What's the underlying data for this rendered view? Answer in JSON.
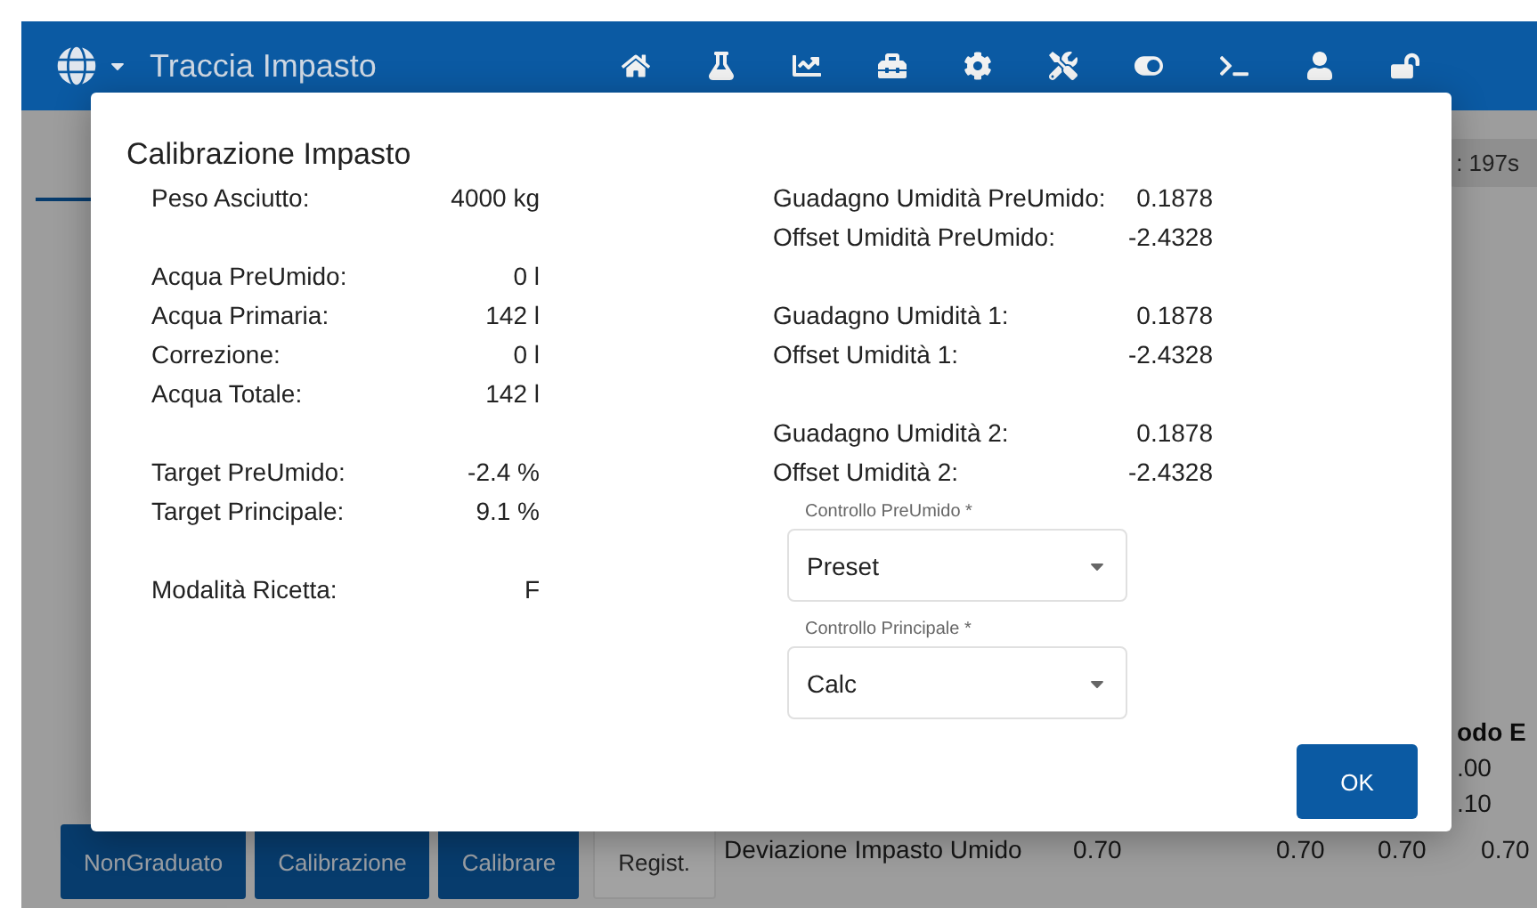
{
  "app_bar": {
    "title": "Traccia Impasto",
    "icons": [
      {
        "kind": "home"
      },
      {
        "kind": "flask"
      },
      {
        "kind": "chart"
      },
      {
        "kind": "toolbox"
      },
      {
        "kind": "gear"
      },
      {
        "kind": "tools"
      },
      {
        "kind": "toggle"
      },
      {
        "kind": "terminal"
      },
      {
        "kind": "user"
      },
      {
        "kind": "unlock"
      }
    ]
  },
  "timer_chip": ": 197s",
  "table": {
    "header": "odo E",
    "column_values": [
      ".00",
      ".10"
    ],
    "row": {
      "label": "Deviazione Impasto Umido",
      "values": [
        "0.70",
        "0.70",
        "0.70",
        "0.70"
      ]
    }
  },
  "buttons": [
    {
      "label": "NonGraduato",
      "kind": "primary"
    },
    {
      "label": "Calibrazione",
      "kind": "primary"
    },
    {
      "label": "Calibrare",
      "kind": "primary"
    },
    {
      "label": "Regist.",
      "kind": "secondary"
    }
  ],
  "dialog": {
    "title": "Calibrazione Impasto",
    "left_groups": [
      [
        {
          "label": "Peso Asciutto:",
          "value": "4000 kg"
        }
      ],
      [
        {
          "label": "Acqua PreUmido:",
          "value": "0 l"
        },
        {
          "label": "Acqua Primaria:",
          "value": "142 l"
        },
        {
          "label": "Correzione:",
          "value": "0 l"
        },
        {
          "label": "Acqua Totale:",
          "value": "142 l"
        }
      ],
      [
        {
          "label": "Target PreUmido:",
          "value": "-2.4 %"
        },
        {
          "label": "Target Principale:",
          "value": "9.1 %"
        }
      ],
      [
        {
          "label": "Modalità Ricetta:",
          "value": "F"
        }
      ]
    ],
    "right_groups": [
      [
        {
          "label": "Guadagno Umidità PreUmido:",
          "value": "0.1878"
        },
        {
          "label": "Offset Umidità PreUmido:",
          "value": "-2.4328"
        }
      ],
      [
        {
          "label": "Guadagno Umidità 1:",
          "value": "0.1878"
        },
        {
          "label": "Offset Umidità 1:",
          "value": "-2.4328"
        }
      ],
      [
        {
          "label": "Guadagno Umidità 2:",
          "value": "0.1878"
        },
        {
          "label": "Offset Umidità 2:",
          "value": "-2.4328"
        }
      ]
    ],
    "selects": [
      {
        "label": "Controllo PreUmido *",
        "value": "Preset"
      },
      {
        "label": "Controllo Principale *",
        "value": "Calc"
      }
    ],
    "ok_button": "OK"
  }
}
